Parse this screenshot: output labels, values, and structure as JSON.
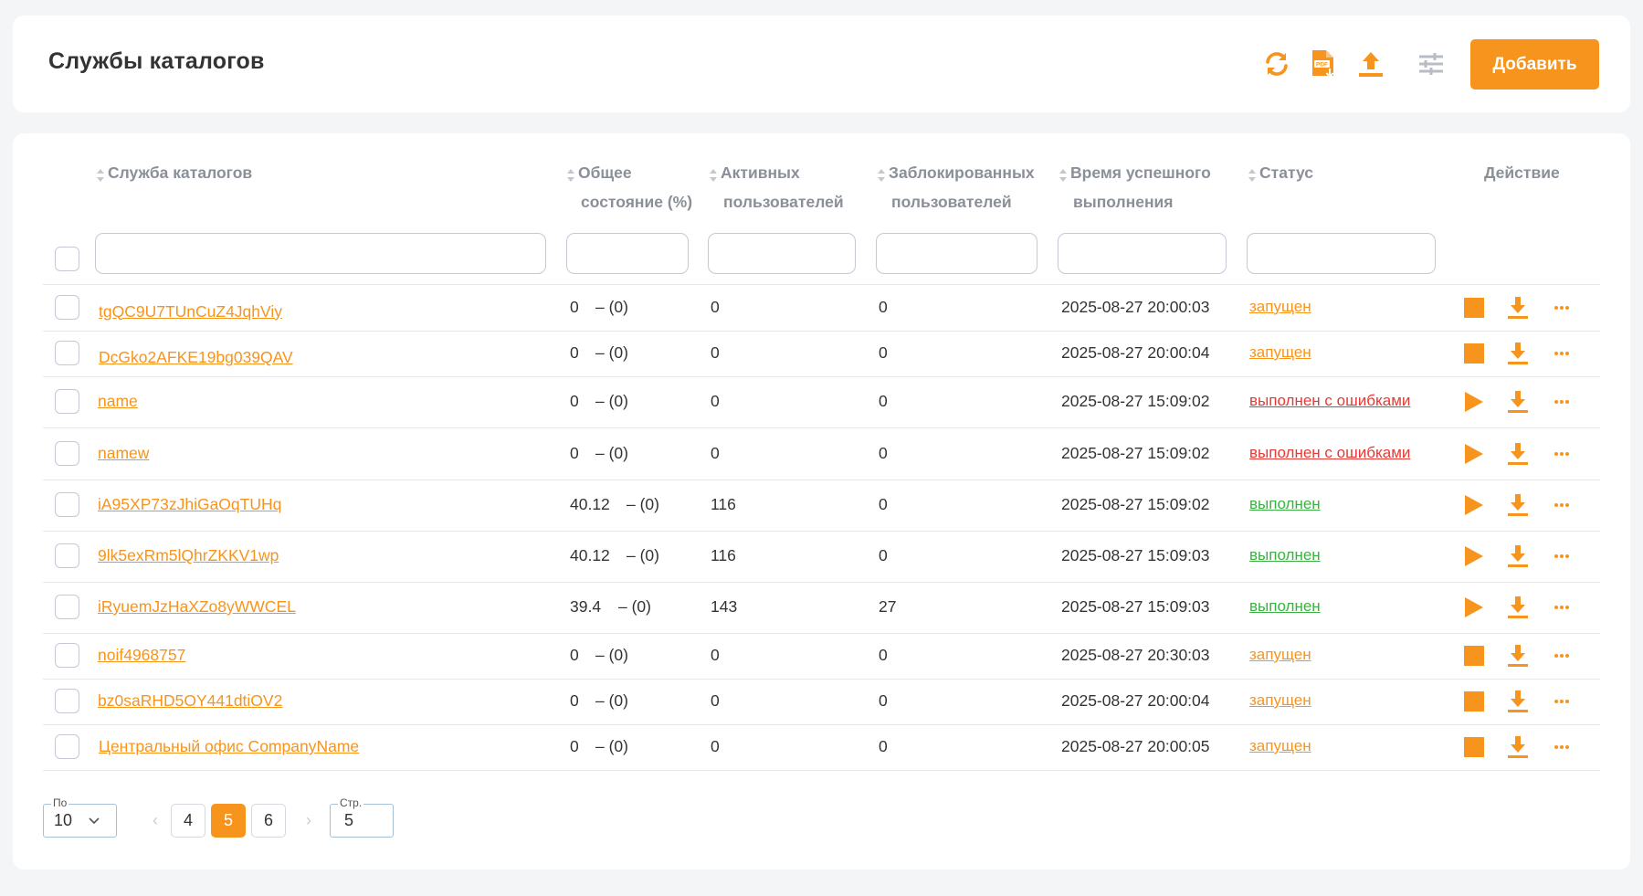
{
  "header": {
    "title": "Службы каталогов",
    "add_label": "Добавить",
    "accent": "#f7941d"
  },
  "columns": {
    "service": "Служба каталогов",
    "state_1": "Общее",
    "state_2": "состояние (%)",
    "active_1": "Активных",
    "active_2": "пользователей",
    "blocked_1": "Заблокированных",
    "blocked_2": "пользователей",
    "time_1": "Время успешного",
    "time_2": "выполнения",
    "status": "Статус",
    "action": "Действие"
  },
  "rows": [
    {
      "name": "tgQC9U7TUnCuZ4JqhViy",
      "state": "0",
      "state_extra": "– (0)",
      "active": "0",
      "blocked": "0",
      "time": "2025-08-27 20:00:03",
      "status": "запущен",
      "status_color": "#f7941d",
      "action_icon": "stop-icon"
    },
    {
      "name": "DcGko2AFKE19bg039QAV",
      "state": "0",
      "state_extra": "– (0)",
      "active": "0",
      "blocked": "0",
      "time": "2025-08-27 20:00:04",
      "status": "запущен",
      "status_color": "#f7941d",
      "action_icon": "stop-icon"
    },
    {
      "name": "name",
      "state": "0",
      "state_extra": "– (0)",
      "active": "0",
      "blocked": "0",
      "time": "2025-08-27 15:09:02",
      "status": "выполнен с ошибками",
      "status_color": "#e53935",
      "action_icon": "play-icon"
    },
    {
      "name": "namew",
      "state": "0",
      "state_extra": "– (0)",
      "active": "0",
      "blocked": "0",
      "time": "2025-08-27 15:09:02",
      "status": "выполнен с ошибками",
      "status_color": "#e53935",
      "action_icon": "play-icon"
    },
    {
      "name": "iA95XP73zJhiGaOqTUHq",
      "state": "40.12",
      "state_extra": "– (0)",
      "active": "116",
      "blocked": "0",
      "time": "2025-08-27 15:09:02",
      "status": "выполнен",
      "status_color": "#3cb043",
      "action_icon": "play-icon"
    },
    {
      "name": "9lk5exRm5lQhrZKKV1wp",
      "state": "40.12",
      "state_extra": "– (0)",
      "active": "116",
      "blocked": "0",
      "time": "2025-08-27 15:09:03",
      "status": "выполнен",
      "status_color": "#3cb043",
      "action_icon": "play-icon"
    },
    {
      "name": "iRyuemJzHaXZo8yWWCEL",
      "state": "39.4",
      "state_extra": "– (0)",
      "active": "143",
      "blocked": "27",
      "time": "2025-08-27 15:09:03",
      "status": "выполнен",
      "status_color": "#3cb043",
      "action_icon": "play-icon"
    },
    {
      "name": "noif4968757",
      "state": "0",
      "state_extra": "– (0)",
      "active": "0",
      "blocked": "0",
      "time": "2025-08-27 20:30:03",
      "status": "запущен",
      "status_color": "#f7941d",
      "action_icon": "stop-icon"
    },
    {
      "name": "bz0saRHD5OY441dtiOV2",
      "state": "0",
      "state_extra": "– (0)",
      "active": "0",
      "blocked": "0",
      "time": "2025-08-27 20:00:04",
      "status": "запущен",
      "status_color": "#f7941d",
      "action_icon": "stop-icon"
    },
    {
      "name": "Центральный офис CompanyName",
      "state": "0",
      "state_extra": "– (0)",
      "active": "0",
      "blocked": "0",
      "time": "2025-08-27 20:00:05",
      "status": "запущен",
      "status_color": "#f7941d",
      "action_icon": "stop-icon"
    }
  ],
  "pagination": {
    "per_page_label": "По",
    "per_page_value": "10",
    "pages": [
      "4",
      "5",
      "6"
    ],
    "current_page": "5",
    "goto_label": "Стр.",
    "goto_value": "5"
  }
}
